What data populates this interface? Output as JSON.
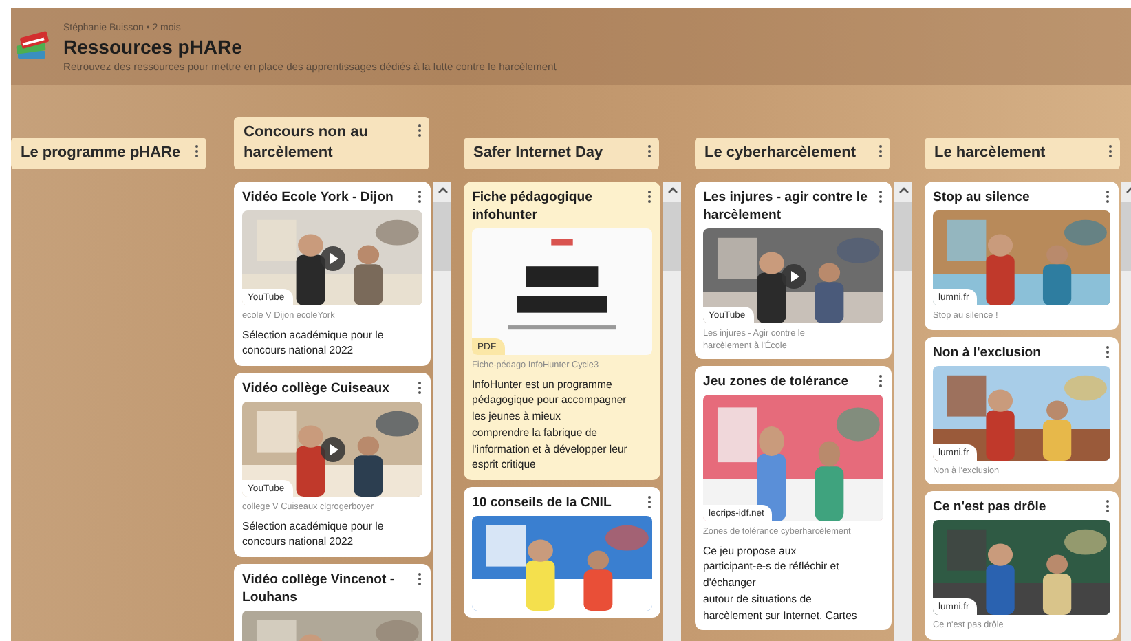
{
  "board": {
    "author": "Stéphanie Buisson • 2 mois",
    "title": "Ressources pHARe",
    "description": "Retrouvez des ressources pour mettre en place des apprentissages dédiés à la lutte contre le harcèlement"
  },
  "columns": [
    {
      "title": "Le programme pHARe"
    },
    {
      "title": "Concours non au harcèlement",
      "posts": [
        {
          "title": "Vidéo Ecole York - Dijon",
          "kind": "video",
          "color": "#ffffff",
          "source": "YouTube",
          "caption": "ecole V Dijon ecoleYork",
          "description": "Sélection académique pour le\nconcours national 2022"
        },
        {
          "title": "Vidéo collège Cuiseaux",
          "kind": "video",
          "color": "#ffffff",
          "source": "YouTube",
          "caption": "college V Cuiseaux clgrogerboyer",
          "description": "Sélection académique pour le\nconcours national 2022"
        },
        {
          "title": "Vidéo collège Vincenot - Louhans",
          "color": "#ffffff"
        }
      ]
    },
    {
      "title": "Safer Internet Day",
      "posts": [
        {
          "title": "Fiche pédagogique infohunter",
          "kind": "pdf",
          "color": "#fdf1cc",
          "source": "PDF",
          "caption": "Fiche-pédago InfoHunter Cycle3",
          "description": "InfoHunter est un programme\npédagogique pour accompagner\nles jeunes à mieux\ncomprendre la fabrique de\nl'information et à développer leur\nesprit critique"
        },
        {
          "title": "10 conseils de la CNIL",
          "color": "#ffffff"
        }
      ]
    },
    {
      "title": "Le cyberharcèlement",
      "posts": [
        {
          "title": "Les injures - agir contre le harcèlement",
          "kind": "video",
          "color": "#ffffff",
          "source": "YouTube",
          "caption": "Les injures - Agir contre le\nharcèlement à l'École"
        },
        {
          "title": "Jeu zones de tolérance",
          "color": "#ffffff",
          "source": "lecrips-idf.net",
          "caption": "Zones de tolérance cyberharcèlement",
          "description": "Ce jeu propose aux\nparticipant-e-s de réfléchir et\nd'échanger\nautour de situations de\nharcèlement sur Internet. Cartes"
        }
      ]
    },
    {
      "title": "Le harcèlement",
      "posts": [
        {
          "title": "Stop au silence",
          "color": "#ffffff",
          "source": "lumni.fr",
          "caption": "Stop au silence !"
        },
        {
          "title": "Non à l'exclusion",
          "color": "#ffffff",
          "source": "lumni.fr",
          "caption": "Non à l'exclusion"
        },
        {
          "title": "Ce n'est pas drôle",
          "color": "#ffffff",
          "source": "lumni.fr",
          "caption": "Ce n'est pas drôle"
        }
      ]
    }
  ]
}
